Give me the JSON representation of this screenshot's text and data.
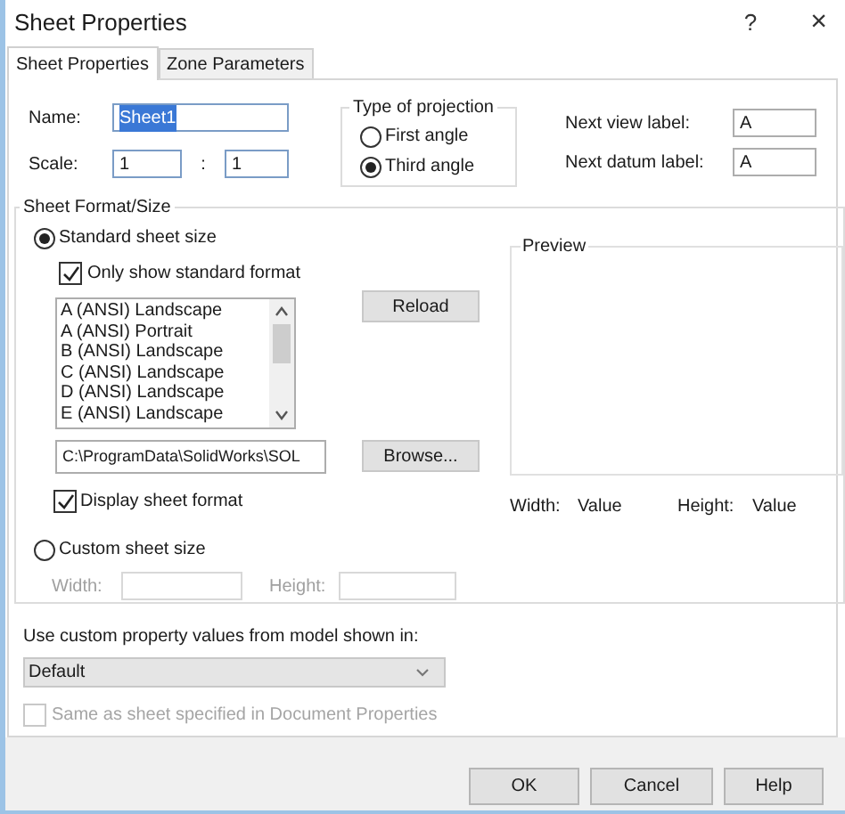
{
  "window": {
    "title": "Sheet Properties",
    "help": "?",
    "close": "×"
  },
  "tabs": [
    {
      "label": "Sheet Properties",
      "selected": true
    },
    {
      "label": "Zone Parameters",
      "selected": false
    }
  ],
  "name": {
    "label": "Name:",
    "value": "Sheet1",
    "text_selected": true
  },
  "scale": {
    "label": "Scale:",
    "numerator": "1",
    "separator": ":",
    "denominator": "1"
  },
  "projection": {
    "title": "Type of projection",
    "options": [
      {
        "label": "First angle",
        "selected": false
      },
      {
        "label": "Third angle",
        "selected": true
      }
    ]
  },
  "next_view_label": {
    "label": "Next view label:",
    "value": "A"
  },
  "next_datum_label": {
    "label": "Next datum label:",
    "value": "A"
  },
  "sheet_format": {
    "title": "Sheet Format/Size",
    "size_options": [
      {
        "label": "Standard sheet size",
        "selected": true
      },
      {
        "label": "Custom sheet size",
        "selected": false
      }
    ],
    "only_standard": {
      "label": "Only show standard format",
      "checked": true
    },
    "formats": [
      {
        "label": "A (ANSI) Landscape",
        "selected": false
      },
      {
        "label": "A (ANSI) Portrait",
        "selected": false
      },
      {
        "label": "B (ANSI) Landscape",
        "selected": false
      },
      {
        "label": "C (ANSI) Landscape",
        "selected": false
      },
      {
        "label": "D (ANSI) Landscape",
        "selected": false
      },
      {
        "label": "E (ANSI) Landscape",
        "selected": false
      }
    ],
    "reload": "Reload",
    "path": "C:\\ProgramData\\SolidWorks\\SOL",
    "browse": "Browse...",
    "display_format": {
      "label": "Display sheet format",
      "checked": true
    },
    "preview": {
      "title": "Preview",
      "width_label": "Width:",
      "width_value": "Value",
      "height_label": "Height:",
      "height_value": "Value"
    },
    "custom": {
      "width_label": "Width:",
      "height_label": "Height:",
      "disabled": true
    }
  },
  "custom_property": {
    "label": "Use custom property values from model shown in:",
    "dropdown": "Default",
    "same_as_sheet": {
      "label": "Same as sheet specified in Document Properties",
      "checked": false,
      "disabled": true
    }
  },
  "buttons": [
    {
      "label": "OK"
    },
    {
      "label": "Cancel"
    },
    {
      "label": "Help"
    }
  ]
}
